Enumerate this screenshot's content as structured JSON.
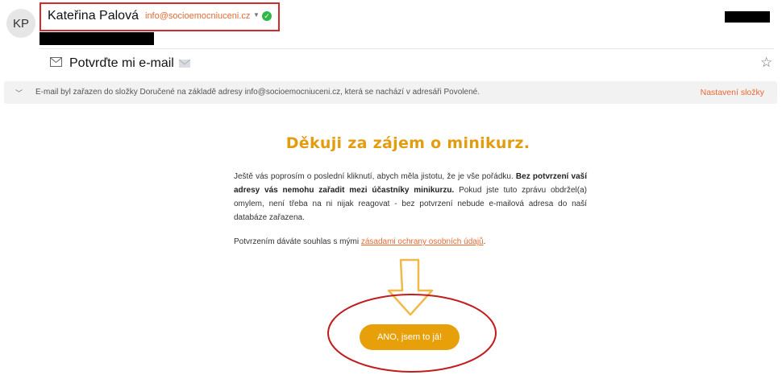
{
  "header": {
    "avatar_initials": "KP",
    "sender_name": "Kateřina Palová",
    "sender_email": "info@socioemocniuceni.cz"
  },
  "subject": {
    "text": "Potvrďte mi e-mail"
  },
  "infobar": {
    "text": "E-mail byl zařazen do složky Doručené na základě adresy info@socioemocniuceni.cz, která se nachází v adresáři Povolené.",
    "link": "Nastavení složky"
  },
  "content": {
    "heading": "Děkuji za zájem o minikurz.",
    "p1_a": "Ještě vás poprosím o poslední kliknutí, abych měla jistotu, že je vše pořádku. ",
    "p1_bold": "Bez potvrzení vaší adresy vás nemohu zařadit mezi účastníky minikurzu.",
    "p1_b": " Pokud jste tuto zprávu obdržel(a) omylem, není třeba na ni nijak reagovat - bez potvrzení nebude e-mailová adresa do naší databáze zařazena.",
    "p2_text": "Potvrzením dáváte souhlas s mými ",
    "p2_link": "zásadami ochrany osobních údajů",
    "p2_end": ".",
    "cta": "ANO, jsem to já!"
  },
  "colors": {
    "accent_orange": "#e8692f",
    "heading_gold": "#e39c0f",
    "button": "#e8a00a",
    "annotation_red": "#d42a2a",
    "verified_green": "#2fb84a"
  }
}
